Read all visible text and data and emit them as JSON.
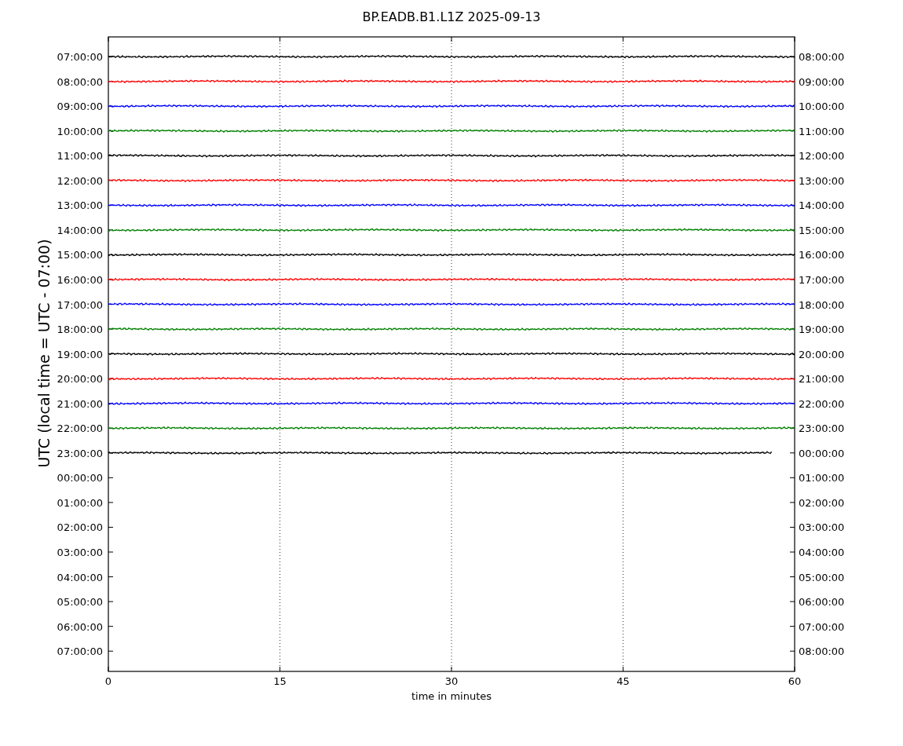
{
  "title": "BP.EADB.B1.L1Z 2025-09-13",
  "ylabel": "UTC (local time = UTC - 07:00)",
  "xlabel": "time in minutes",
  "xticks": [
    "0",
    "15",
    "30",
    "45",
    "60"
  ],
  "rows": [
    {
      "left": "07:00:00",
      "right": "08:00:00",
      "trace": {
        "color": "#000000",
        "level": 1
      }
    },
    {
      "left": "08:00:00",
      "right": "09:00:00",
      "trace": {
        "color": "#ff0000",
        "level": 1
      }
    },
    {
      "left": "09:00:00",
      "right": "10:00:00",
      "trace": {
        "color": "#0000ff",
        "level": 1
      }
    },
    {
      "left": "10:00:00",
      "right": "11:00:00",
      "trace": {
        "color": "#008000",
        "level": 1
      }
    },
    {
      "left": "11:00:00",
      "right": "12:00:00",
      "trace": {
        "color": "#000000",
        "level": 1
      }
    },
    {
      "left": "12:00:00",
      "right": "13:00:00",
      "trace": {
        "color": "#ff0000",
        "level": 1
      }
    },
    {
      "left": "13:00:00",
      "right": "14:00:00",
      "trace": {
        "color": "#0000ff",
        "level": 1
      }
    },
    {
      "left": "14:00:00",
      "right": "15:00:00",
      "trace": {
        "color": "#008000",
        "level": 1
      }
    },
    {
      "left": "15:00:00",
      "right": "16:00:00",
      "trace": {
        "color": "#000000",
        "level": 1
      }
    },
    {
      "left": "16:00:00",
      "right": "17:00:00",
      "trace": {
        "color": "#ff0000",
        "level": 1
      }
    },
    {
      "left": "17:00:00",
      "right": "18:00:00",
      "trace": {
        "color": "#0000ff",
        "level": 1
      }
    },
    {
      "left": "18:00:00",
      "right": "19:00:00",
      "trace": {
        "color": "#008000",
        "level": 1
      }
    },
    {
      "left": "19:00:00",
      "right": "20:00:00",
      "trace": {
        "color": "#000000",
        "level": 1
      }
    },
    {
      "left": "20:00:00",
      "right": "21:00:00",
      "trace": {
        "color": "#ff0000",
        "level": 1
      }
    },
    {
      "left": "21:00:00",
      "right": "22:00:00",
      "trace": {
        "color": "#0000ff",
        "level": 1
      }
    },
    {
      "left": "22:00:00",
      "right": "23:00:00",
      "trace": {
        "color": "#008000",
        "level": 1
      }
    },
    {
      "left": "23:00:00",
      "right": "00:00:00",
      "trace": {
        "color": "#000000",
        "level": 0.967
      }
    },
    {
      "left": "00:00:00",
      "right": "01:00:00"
    },
    {
      "left": "01:00:00",
      "right": "02:00:00"
    },
    {
      "left": "02:00:00",
      "right": "03:00:00"
    },
    {
      "left": "03:00:00",
      "right": "04:00:00"
    },
    {
      "left": "04:00:00",
      "right": "05:00:00"
    },
    {
      "left": "05:00:00",
      "right": "06:00:00"
    },
    {
      "left": "06:00:00",
      "right": "07:00:00"
    },
    {
      "left": "07:00:00",
      "right": "08:00:00"
    }
  ]
}
